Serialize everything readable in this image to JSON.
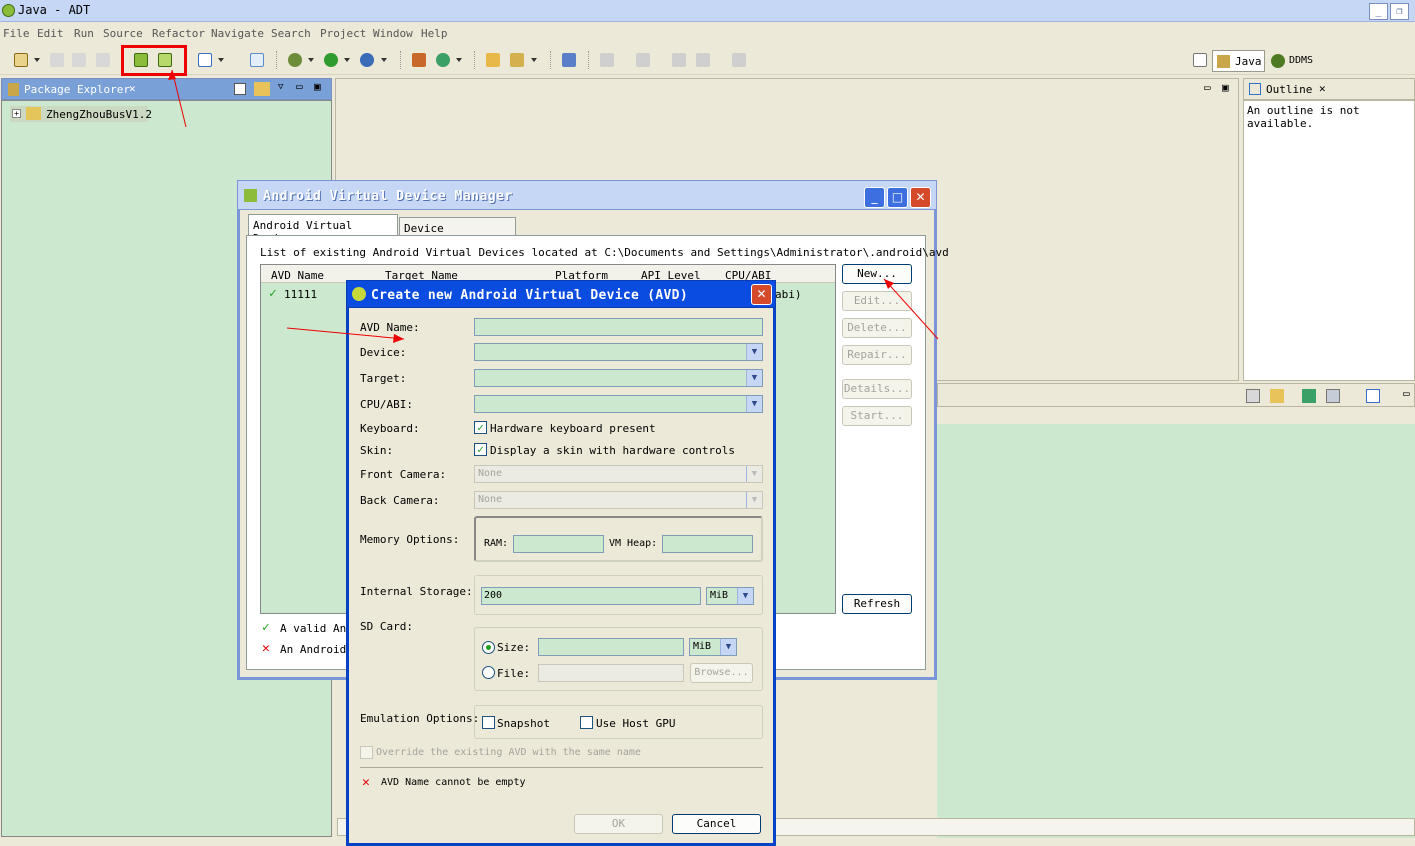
{
  "window": {
    "title": "Java - ADT"
  },
  "menu": [
    "File",
    "Edit",
    "Run",
    "Source",
    "Refactor",
    "Navigate",
    "Search",
    "Project",
    "Window",
    "Help"
  ],
  "perspectives": {
    "java": "Java",
    "ddms": "DDMS"
  },
  "package_explorer": {
    "title": "Package Explorer",
    "project": "ZhengZhouBusV1.2"
  },
  "outline": {
    "title": "Outline",
    "message": "An outline is not available."
  },
  "avd_manager": {
    "title": "Android Virtual Device Manager",
    "tabs": [
      "Android Virtual Devices",
      "Device Definitions"
    ],
    "location": "List of existing Android Virtual Devices located at C:\\Documents and Settings\\Administrator\\.android\\avd",
    "columns": [
      "AVD Name",
      "Target Name",
      "Platform",
      "API Level",
      "CPU/ABI"
    ],
    "rows": [
      {
        "name": "11111",
        "abi_suffix": "abi)"
      }
    ],
    "buttons": {
      "new": "New...",
      "edit": "Edit...",
      "delete": "Delete...",
      "repair": "Repair...",
      "details": "Details...",
      "start": "Start...",
      "refresh": "Refresh"
    },
    "legend_valid": "A valid And",
    "legend_invalid": "An Android"
  },
  "dialog": {
    "title": "Create new Android Virtual Device (AVD)",
    "labels": {
      "avd_name": "AVD Name:",
      "device": "Device:",
      "target": "Target:",
      "cpu_abi": "CPU/ABI:",
      "keyboard": "Keyboard:",
      "skin": "Skin:",
      "front_camera": "Front Camera:",
      "back_camera": "Back Camera:",
      "memory": "Memory Options:",
      "ram": "RAM:",
      "vm_heap": "VM Heap:",
      "internal_storage": "Internal Storage:",
      "sd_card": "SD Card:",
      "size": "Size:",
      "file": "File:",
      "emulation": "Emulation Options:"
    },
    "keyboard_check": "Hardware keyboard present",
    "skin_check": "Display a skin with hardware controls",
    "front_camera_value": "None",
    "back_camera_value": "None",
    "internal_storage_value": "200",
    "internal_storage_unit": "MiB",
    "sd_unit": "MiB",
    "browse": "Browse...",
    "snapshot": "Snapshot",
    "use_host_gpu": "Use Host GPU",
    "override": "Override the existing AVD with the same name",
    "error": "AVD Name cannot be empty",
    "ok": "OK",
    "cancel": "Cancel"
  },
  "colors": {
    "highlight": "#e00000",
    "field": "#cce8cf",
    "xp_title": "#0a4be0"
  }
}
